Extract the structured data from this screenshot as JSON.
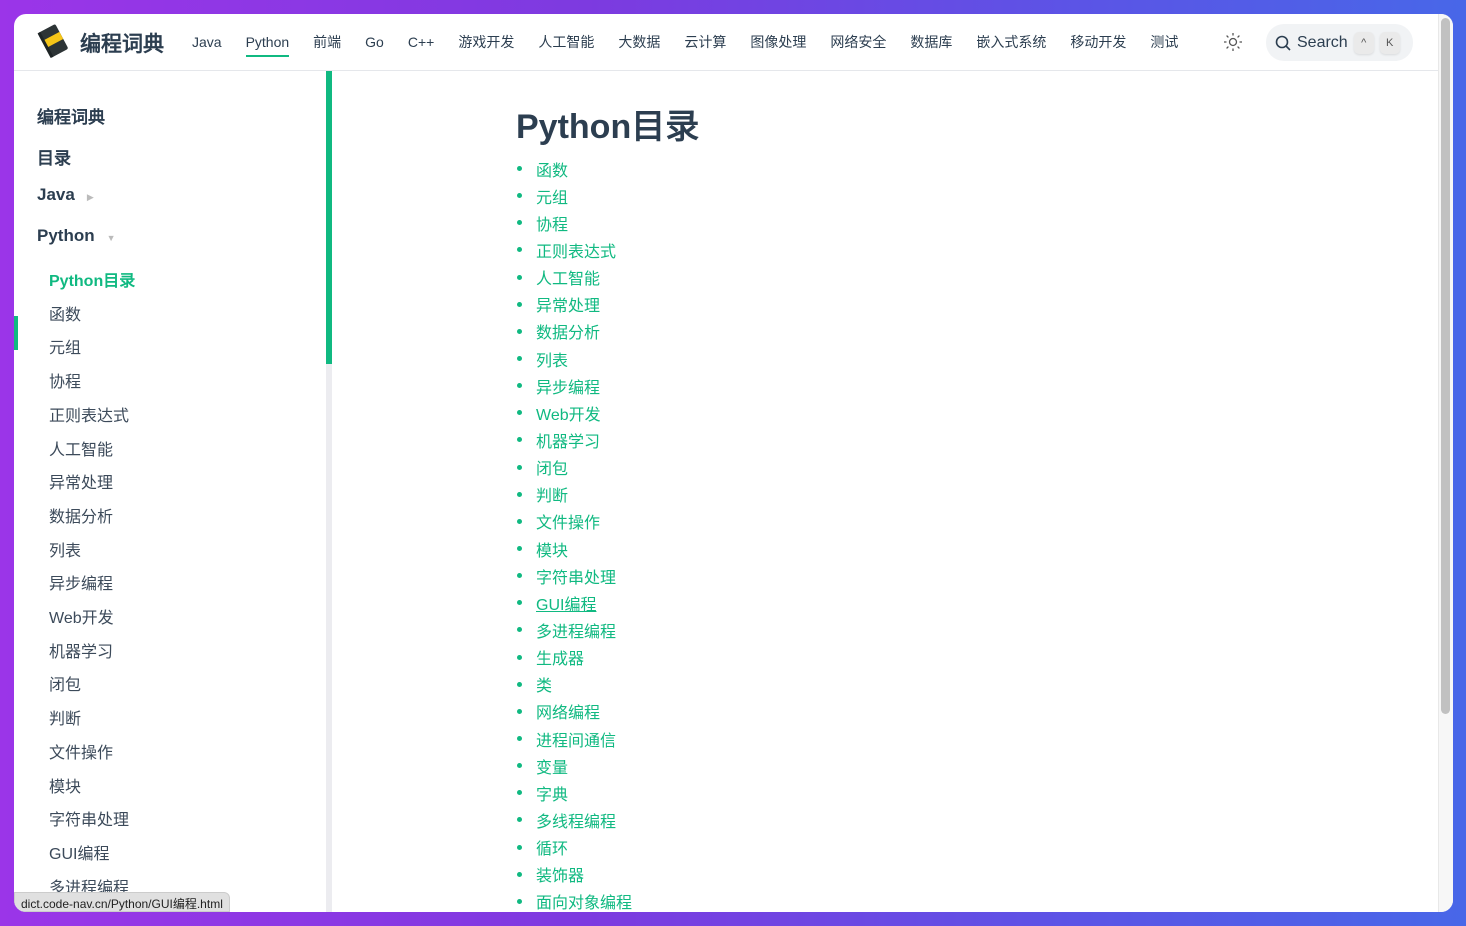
{
  "header": {
    "brand": "编程词典",
    "nav": [
      "Java",
      "Python",
      "前端",
      "Go",
      "C++",
      "游戏开发",
      "人工智能",
      "大数据",
      "云计算",
      "图像处理",
      "网络安全",
      "数据库",
      "嵌入式系统",
      "移动开发",
      "测试"
    ],
    "active_nav": "Python",
    "theme_icon": "sun-icon",
    "search": {
      "label": "Search",
      "keys": [
        "^",
        "K"
      ]
    }
  },
  "sidebar": {
    "sections": [
      "编程词典",
      "目录",
      "Java",
      "Python"
    ],
    "items": [
      "Python目录",
      "函数",
      "元组",
      "协程",
      "正则表达式",
      "人工智能",
      "异常处理",
      "数据分析",
      "列表",
      "异步编程",
      "Web开发",
      "机器学习",
      "闭包",
      "判断",
      "文件操作",
      "模块",
      "字符串处理",
      "GUI编程",
      "多进程编程"
    ],
    "active": "Python目录"
  },
  "main": {
    "title": "Python目录",
    "links": [
      "函数",
      "元组",
      "协程",
      "正则表达式",
      "人工智能",
      "异常处理",
      "数据分析",
      "列表",
      "异步编程",
      "Web开发",
      "机器学习",
      "闭包",
      "判断",
      "文件操作",
      "模块",
      "字符串处理",
      "GUI编程",
      "多进程编程",
      "生成器",
      "类",
      "网络编程",
      "进程间通信",
      "变量",
      "字典",
      "多线程编程",
      "循环",
      "装饰器",
      "面向对象编程"
    ],
    "hovered": "GUI编程"
  },
  "status_url": "dict.code-nav.cn/Python/GUI编程.html",
  "colors": {
    "accent": "#10b981",
    "text": "#2c3e50"
  }
}
